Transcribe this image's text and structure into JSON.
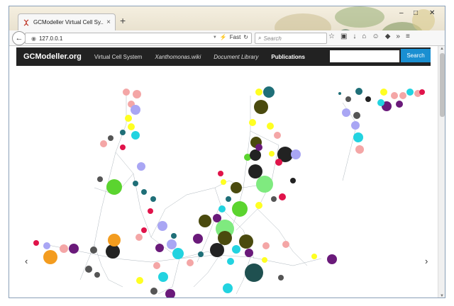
{
  "browser": {
    "tab_title": "GCModeller Virtual Cell Sy...",
    "url": "127.0.0.1",
    "url_fast_label": "Fast",
    "search_placeholder": "Search"
  },
  "site": {
    "brand": "GCModeller.org",
    "nav": [
      "Virtual Cell System",
      "Xanthomonas.wiki",
      "Document Library",
      "Publications"
    ],
    "search_button": "Search"
  },
  "icons": {
    "new_tab": "+",
    "back": "←",
    "close": "×",
    "carousel_prev": "‹",
    "carousel_next": "›"
  },
  "colors": {
    "nav_bg": "#222222",
    "search_btn": "#1a8fd1",
    "node_green": "#5bd42f",
    "node_teal": "#1f6f78",
    "node_pink": "#f4a6a6",
    "node_yellow": "#ffff22",
    "node_cyan": "#22d3e0",
    "node_purple": "#6a1a7a",
    "node_red": "#e0134a"
  }
}
